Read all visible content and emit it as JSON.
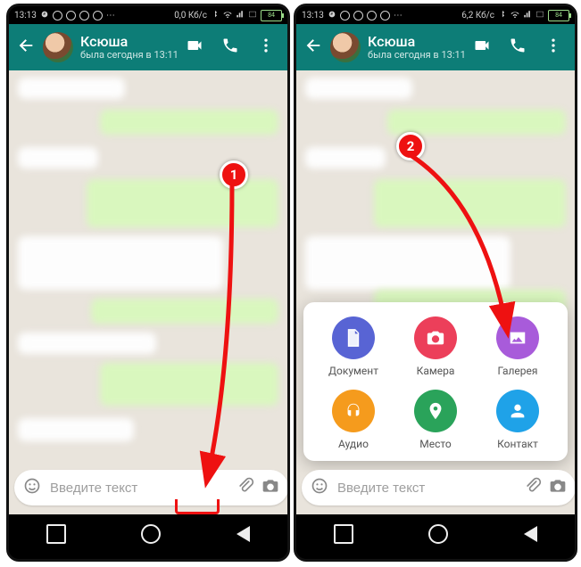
{
  "status": {
    "time": "13:13",
    "speed_left": "0,0 Кб/с",
    "speed_right": "6,2 Кб/с",
    "battery": "84"
  },
  "chat": {
    "name": "Ксюша",
    "last_seen": "была сегодня в 13:11"
  },
  "composer": {
    "placeholder": "Введите текст"
  },
  "attachments": [
    {
      "key": "document",
      "label": "Документ",
      "color": "#5864d4"
    },
    {
      "key": "camera",
      "label": "Камера",
      "color": "#ec3f5a"
    },
    {
      "key": "gallery",
      "label": "Галерея",
      "color": "#a85bda"
    },
    {
      "key": "audio",
      "label": "Аудио",
      "color": "#f59b1d"
    },
    {
      "key": "location",
      "label": "Место",
      "color": "#2aa35a"
    },
    {
      "key": "contact",
      "label": "Контакт",
      "color": "#1fa2e8"
    }
  ],
  "callouts": {
    "one": "1",
    "two": "2"
  }
}
